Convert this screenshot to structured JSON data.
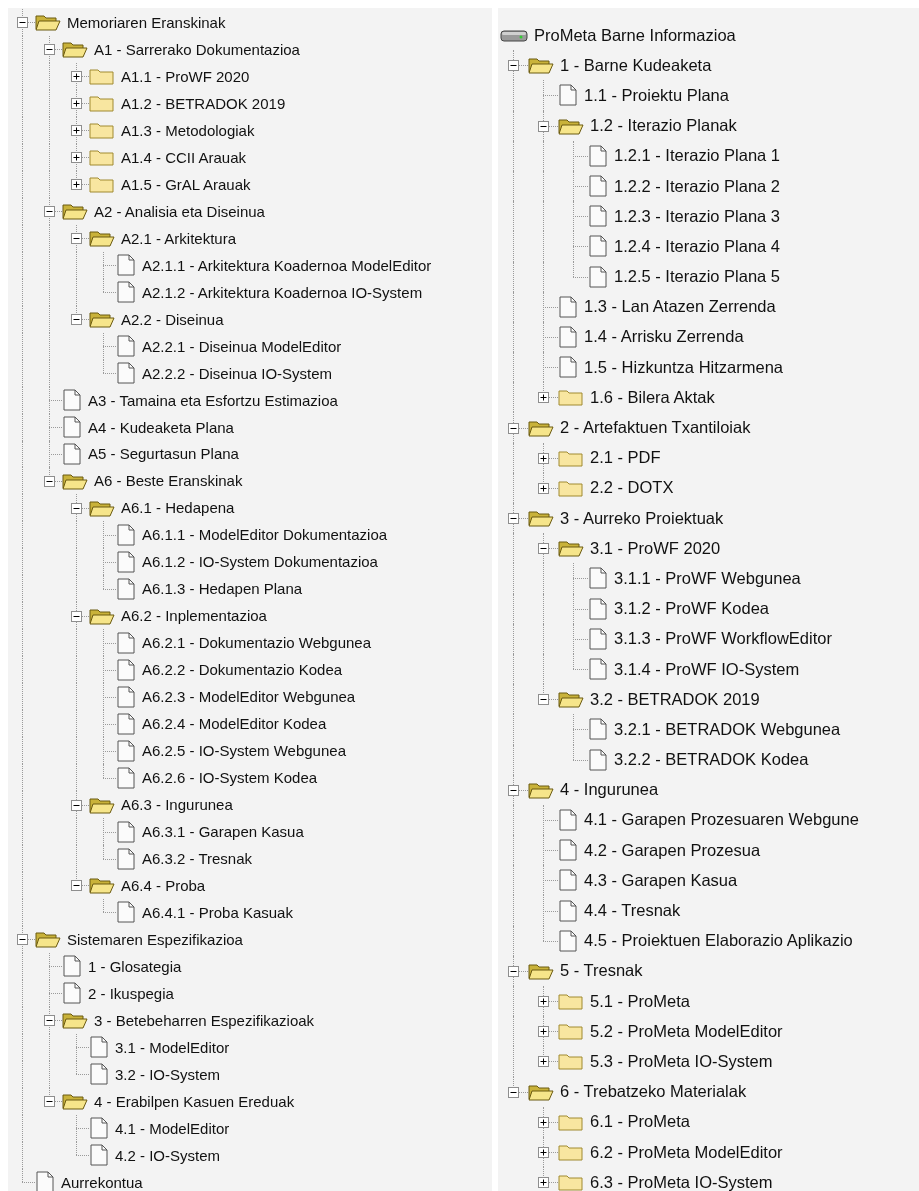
{
  "left_tree": {
    "nodes": [
      {
        "label": "Memoriaren Eranskinak",
        "kind": "folder",
        "expanded": true,
        "children": [
          {
            "label": "A1 - Sarrerako Dokumentazioa",
            "kind": "folder",
            "expanded": true,
            "children": [
              {
                "label": "A1.1 - ProWF 2020",
                "kind": "folder",
                "expanded": false
              },
              {
                "label": "A1.2 - BETRADOK 2019",
                "kind": "folder",
                "expanded": false
              },
              {
                "label": "A1.3 - Metodologiak",
                "kind": "folder",
                "expanded": false
              },
              {
                "label": "A1.4 - CCII Arauak",
                "kind": "folder",
                "expanded": false
              },
              {
                "label": "A1.5 - GrAL Arauak",
                "kind": "folder",
                "expanded": false
              }
            ]
          },
          {
            "label": "A2 - Analisia eta Diseinua",
            "kind": "folder",
            "expanded": true,
            "children": [
              {
                "label": "A2.1 - Arkitektura",
                "kind": "folder",
                "expanded": true,
                "children": [
                  {
                    "label": "A2.1.1 - Arkitektura Koadernoa ModelEditor",
                    "kind": "file"
                  },
                  {
                    "label": "A2.1.2 - Arkitektura Koadernoa IO-System",
                    "kind": "file"
                  }
                ]
              },
              {
                "label": "A2.2 - Diseinua",
                "kind": "folder",
                "expanded": true,
                "children": [
                  {
                    "label": "A2.2.1 - Diseinua ModelEditor",
                    "kind": "file"
                  },
                  {
                    "label": "A2.2.2 - Diseinua IO-System",
                    "kind": "file"
                  }
                ]
              }
            ]
          },
          {
            "label": "A3 - Tamaina eta Esfortzu Estimazioa",
            "kind": "file"
          },
          {
            "label": "A4 - Kudeaketa Plana",
            "kind": "file"
          },
          {
            "label": "A5 - Segurtasun Plana",
            "kind": "file"
          },
          {
            "label": "A6 - Beste Eranskinak",
            "kind": "folder",
            "expanded": true,
            "children": [
              {
                "label": "A6.1 - Hedapena",
                "kind": "folder",
                "expanded": true,
                "children": [
                  {
                    "label": "A6.1.1 - ModelEditor Dokumentazioa",
                    "kind": "file"
                  },
                  {
                    "label": "A6.1.2 - IO-System Dokumentazioa",
                    "kind": "file"
                  },
                  {
                    "label": "A6.1.3 - Hedapen Plana",
                    "kind": "file"
                  }
                ]
              },
              {
                "label": "A6.2 - Inplementazioa",
                "kind": "folder",
                "expanded": true,
                "children": [
                  {
                    "label": "A6.2.1 - Dokumentazio Webgunea",
                    "kind": "file"
                  },
                  {
                    "label": "A6.2.2 - Dokumentazio Kodea",
                    "kind": "file"
                  },
                  {
                    "label": "A6.2.3 - ModelEditor Webgunea",
                    "kind": "file"
                  },
                  {
                    "label": "A6.2.4 - ModelEditor Kodea",
                    "kind": "file"
                  },
                  {
                    "label": "A6.2.5 - IO-System Webgunea",
                    "kind": "file"
                  },
                  {
                    "label": "A6.2.6 - IO-System Kodea",
                    "kind": "file"
                  }
                ]
              },
              {
                "label": "A6.3 - Ingurunea",
                "kind": "folder",
                "expanded": true,
                "children": [
                  {
                    "label": "A6.3.1 - Garapen Kasua",
                    "kind": "file"
                  },
                  {
                    "label": "A6.3.2 - Tresnak",
                    "kind": "file"
                  }
                ]
              },
              {
                "label": "A6.4 - Proba",
                "kind": "folder",
                "expanded": true,
                "children": [
                  {
                    "label": "A6.4.1 - Proba Kasuak",
                    "kind": "file"
                  }
                ]
              }
            ]
          }
        ]
      },
      {
        "label": "Sistemaren Espezifikazioa",
        "kind": "folder",
        "expanded": true,
        "children": [
          {
            "label": "1 - Glosategia",
            "kind": "file"
          },
          {
            "label": "2 - Ikuspegia",
            "kind": "file"
          },
          {
            "label": "3 - Betebeharren Espezifikazioak",
            "kind": "folder",
            "expanded": true,
            "children": [
              {
                "label": "3.1 - ModelEditor",
                "kind": "file"
              },
              {
                "label": "3.2 - IO-System",
                "kind": "file"
              }
            ]
          },
          {
            "label": "4 - Erabilpen Kasuen Ereduak",
            "kind": "folder",
            "expanded": true,
            "children": [
              {
                "label": "4.1 - ModelEditor",
                "kind": "file"
              },
              {
                "label": "4.2 - IO-System",
                "kind": "file"
              }
            ]
          }
        ]
      },
      {
        "label": "Aurrekontua",
        "kind": "file"
      }
    ]
  },
  "right_tree": {
    "root": {
      "label": "ProMeta Barne Informazioa",
      "kind": "drive"
    },
    "nodes": [
      {
        "label": "1 - Barne Kudeaketa",
        "kind": "folder",
        "expanded": true,
        "children": [
          {
            "label": "1.1 - Proiektu Plana",
            "kind": "file"
          },
          {
            "label": "1.2 - Iterazio Planak",
            "kind": "folder",
            "expanded": true,
            "children": [
              {
                "label": "1.2.1 - Iterazio Plana 1",
                "kind": "file"
              },
              {
                "label": "1.2.2 - Iterazio Plana 2",
                "kind": "file"
              },
              {
                "label": "1.2.3 - Iterazio Plana 3",
                "kind": "file"
              },
              {
                "label": "1.2.4 - Iterazio Plana 4",
                "kind": "file"
              },
              {
                "label": "1.2.5 - Iterazio Plana 5",
                "kind": "file"
              }
            ]
          },
          {
            "label": "1.3 - Lan Atazen Zerrenda",
            "kind": "file"
          },
          {
            "label": "1.4 - Arrisku Zerrenda",
            "kind": "file"
          },
          {
            "label": "1.5 - Hizkuntza Hitzarmena",
            "kind": "file"
          },
          {
            "label": "1.6 - Bilera Aktak",
            "kind": "folder",
            "expanded": false
          }
        ]
      },
      {
        "label": "2 - Artefaktuen Txantiloiak",
        "kind": "folder",
        "expanded": true,
        "children": [
          {
            "label": "2.1 - PDF",
            "kind": "folder",
            "expanded": false
          },
          {
            "label": "2.2 - DOTX",
            "kind": "folder",
            "expanded": false
          }
        ]
      },
      {
        "label": "3 - Aurreko Proiektuak",
        "kind": "folder",
        "expanded": true,
        "children": [
          {
            "label": "3.1 - ProWF 2020",
            "kind": "folder",
            "expanded": true,
            "children": [
              {
                "label": "3.1.1 - ProWF Webgunea",
                "kind": "file"
              },
              {
                "label": "3.1.2 - ProWF Kodea",
                "kind": "file"
              },
              {
                "label": "3.1.3 - ProWF WorkflowEditor",
                "kind": "file"
              },
              {
                "label": "3.1.4 - ProWF IO-System",
                "kind": "file"
              }
            ]
          },
          {
            "label": "3.2 - BETRADOK 2019",
            "kind": "folder",
            "expanded": true,
            "children": [
              {
                "label": "3.2.1 - BETRADOK Webgunea",
                "kind": "file"
              },
              {
                "label": "3.2.2 - BETRADOK Kodea",
                "kind": "file"
              }
            ]
          }
        ]
      },
      {
        "label": "4 - Ingurunea",
        "kind": "folder",
        "expanded": true,
        "children": [
          {
            "label": "4.1 - Garapen Prozesuaren Webgune",
            "kind": "file"
          },
          {
            "label": "4.2 - Garapen Prozesua",
            "kind": "file"
          },
          {
            "label": "4.3 - Garapen Kasua",
            "kind": "file"
          },
          {
            "label": "4.4 - Tresnak",
            "kind": "file"
          },
          {
            "label": "4.5 - Proiektuen Elaborazio Aplikazio",
            "kind": "file"
          }
        ]
      },
      {
        "label": "5 - Tresnak",
        "kind": "folder",
        "expanded": true,
        "children": [
          {
            "label": "5.1 - ProMeta",
            "kind": "folder",
            "expanded": false
          },
          {
            "label": "5.2 - ProMeta ModelEditor",
            "kind": "folder",
            "expanded": false
          },
          {
            "label": "5.3 - ProMeta IO-System",
            "kind": "folder",
            "expanded": false
          }
        ]
      },
      {
        "label": "6 - Trebatzeko Materialak",
        "kind": "folder",
        "expanded": true,
        "children": [
          {
            "label": "6.1 - ProMeta",
            "kind": "folder",
            "expanded": false
          },
          {
            "label": "6.2 - ProMeta ModelEditor",
            "kind": "folder",
            "expanded": false
          },
          {
            "label": "6.3 - ProMeta IO-System",
            "kind": "folder",
            "expanded": false
          }
        ]
      }
    ]
  }
}
